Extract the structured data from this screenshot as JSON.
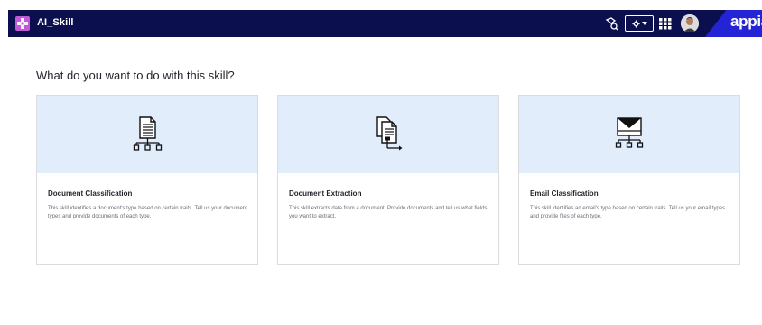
{
  "header": {
    "app_title": "AI_Skill",
    "brand": "appian",
    "icons": {
      "app": "app-icon",
      "skill": "skill-icon",
      "settings": "gear-icon",
      "apps_grid": "grid-icon",
      "avatar": "user-avatar"
    }
  },
  "main": {
    "heading": "What do you want to do with this skill?",
    "cards": [
      {
        "title": "Document Classification",
        "description": "This skill identifies a document's type based on certain traits. Tell us your document types and provide documents of each type.",
        "icon": "document-classification-icon"
      },
      {
        "title": "Document Extraction",
        "description": "This skill extracts data from a document. Provide documents and tell us what fields you want to extract.",
        "icon": "document-extraction-icon"
      },
      {
        "title": "Email Classification",
        "description": "This skill identifies an email's type based on certain traits. Tell us your email types and provide files of each type.",
        "icon": "email-classification-icon"
      }
    ]
  },
  "colors": {
    "topbar": "#0b0f4d",
    "brand_accent": "#2424d6",
    "card_banner": "#e2edfc",
    "app_icon": "#c05bd8"
  }
}
